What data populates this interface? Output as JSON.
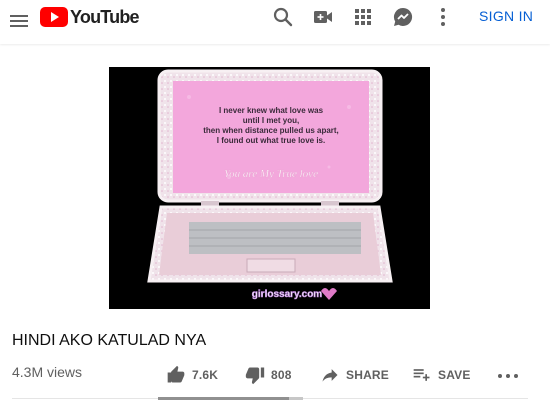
{
  "header": {
    "logo_text": "YouTube",
    "signin_label": "SIGN IN",
    "icons": [
      "menu-icon",
      "search-icon",
      "video-camera-icon",
      "apps-grid-icon",
      "messages-icon",
      "more-vert-icon"
    ]
  },
  "video": {
    "title": "HINDI AKO KATULAD NYA",
    "views": "4.3M views",
    "thumbnail": {
      "quote_lines": [
        "I never knew what love was",
        "until I met you,",
        "then when distance pulled us apart,",
        "I found out what true love is."
      ],
      "caption": "You are My True love",
      "watermark": "girlossary.com"
    }
  },
  "actions": {
    "like_count": "7.6K",
    "dislike_count": "808",
    "share_label": "SHARE",
    "save_label": "SAVE"
  },
  "sentiment": {
    "like_fraction": 0.9
  },
  "colors": {
    "brand_red": "#ff0000",
    "link_blue": "#065fd4",
    "thumbnail_pink": "#f2a6d8"
  }
}
